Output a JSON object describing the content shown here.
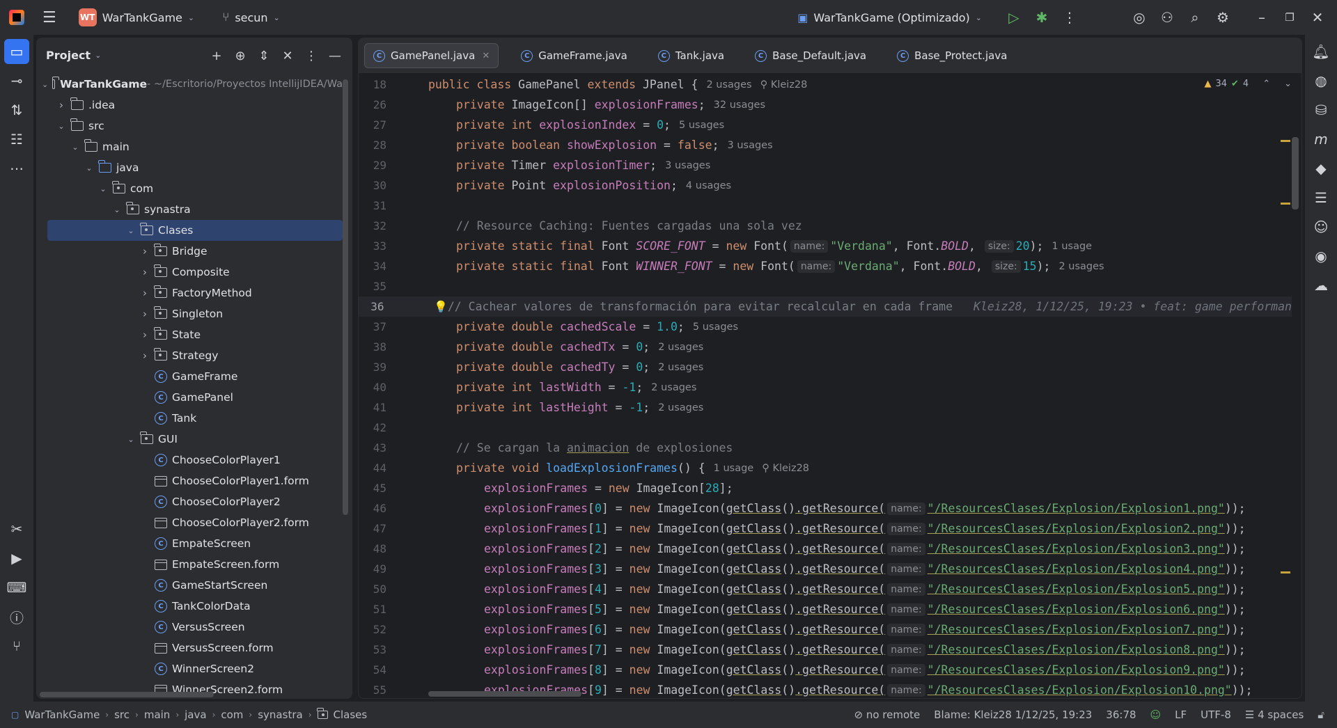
{
  "titlebar": {
    "project_badge": "WT",
    "project_name": "WarTankGame",
    "branch": "secun",
    "run_config": "WarTankGame (Optimizado)"
  },
  "project_panel": {
    "title": "Project",
    "tree": [
      {
        "label": "WarTankGame",
        "suffix": " - ~/Escritorio/Proyectos IntellijIDEA/Wa",
        "depth": 0,
        "kind": "module",
        "expanded": true
      },
      {
        "label": ".idea",
        "depth": 1,
        "kind": "folder",
        "expanded": false
      },
      {
        "label": "src",
        "depth": 1,
        "kind": "folder",
        "expanded": true
      },
      {
        "label": "main",
        "depth": 2,
        "kind": "folder",
        "expanded": true
      },
      {
        "label": "java",
        "depth": 3,
        "kind": "source",
        "expanded": true
      },
      {
        "label": "com",
        "depth": 4,
        "kind": "package",
        "expanded": true
      },
      {
        "label": "synastra",
        "depth": 5,
        "kind": "package",
        "expanded": true
      },
      {
        "label": "Clases",
        "depth": 6,
        "kind": "package",
        "expanded": true,
        "selected": true
      },
      {
        "label": "Bridge",
        "depth": 7,
        "kind": "package",
        "expanded": false
      },
      {
        "label": "Composite",
        "depth": 7,
        "kind": "package",
        "expanded": false
      },
      {
        "label": "FactoryMethod",
        "depth": 7,
        "kind": "package",
        "expanded": false
      },
      {
        "label": "Singleton",
        "depth": 7,
        "kind": "package",
        "expanded": false
      },
      {
        "label": "State",
        "depth": 7,
        "kind": "package",
        "expanded": false
      },
      {
        "label": "Strategy",
        "depth": 7,
        "kind": "package",
        "expanded": false
      },
      {
        "label": "GameFrame",
        "depth": 7,
        "kind": "class"
      },
      {
        "label": "GamePanel",
        "depth": 7,
        "kind": "class"
      },
      {
        "label": "Tank",
        "depth": 7,
        "kind": "class"
      },
      {
        "label": "GUI",
        "depth": 6,
        "kind": "package",
        "expanded": true
      },
      {
        "label": "ChooseColorPlayer1",
        "depth": 7,
        "kind": "class"
      },
      {
        "label": "ChooseColorPlayer1.form",
        "depth": 7,
        "kind": "form"
      },
      {
        "label": "ChooseColorPlayer2",
        "depth": 7,
        "kind": "class"
      },
      {
        "label": "ChooseColorPlayer2.form",
        "depth": 7,
        "kind": "form"
      },
      {
        "label": "EmpateScreen",
        "depth": 7,
        "kind": "class"
      },
      {
        "label": "EmpateScreen.form",
        "depth": 7,
        "kind": "form"
      },
      {
        "label": "GameStartScreen",
        "depth": 7,
        "kind": "class"
      },
      {
        "label": "TankColorData",
        "depth": 7,
        "kind": "class"
      },
      {
        "label": "VersusScreen",
        "depth": 7,
        "kind": "class"
      },
      {
        "label": "VersusScreen.form",
        "depth": 7,
        "kind": "form"
      },
      {
        "label": "WinnerScreen2",
        "depth": 7,
        "kind": "class"
      },
      {
        "label": "WinnerScreen2.form",
        "depth": 7,
        "kind": "form"
      }
    ]
  },
  "tabs": [
    {
      "label": "GamePanel.java",
      "active": true
    },
    {
      "label": "GameFrame.java"
    },
    {
      "label": "Tank.java"
    },
    {
      "label": "Base_Default.java"
    },
    {
      "label": "Base_Protect.java"
    }
  ],
  "inspections": {
    "warnings": "34",
    "ok": "4"
  },
  "code": {
    "l18": {
      "n": "18",
      "kw1": "public class ",
      "name": "GamePanel",
      "kw2": " extends ",
      "sup": "JPanel",
      "brace": " {",
      "hint": "2 usages",
      "author": "Kleiz28"
    },
    "l26": {
      "n": "26",
      "kw": "private ",
      "type": "ImageIcon[] ",
      "fld": "explosionFrames",
      "end": ";",
      "hint": "32 usages"
    },
    "l27": {
      "n": "27",
      "kw": "private int ",
      "fld": "explosionIndex",
      "eq": " = ",
      "num": "0",
      "end": ";",
      "hint": "5 usages"
    },
    "l28": {
      "n": "28",
      "kw": "private boolean ",
      "fld": "showExplosion",
      "eq": " = ",
      "val": "false",
      "end": ";",
      "hint": "3 usages"
    },
    "l29": {
      "n": "29",
      "kw": "private ",
      "type": "Timer ",
      "fld": "explosionTimer",
      "end": ";",
      "hint": "3 usages"
    },
    "l30": {
      "n": "30",
      "kw": "private ",
      "type": "Point ",
      "fld": "explosionPosition",
      "end": ";",
      "hint": "4 usages"
    },
    "l31": {
      "n": "31"
    },
    "l32": {
      "n": "32",
      "cmt": "// Resource Caching: Fuentes cargadas una sola vez"
    },
    "l33": {
      "n": "33",
      "kw": "private static final ",
      "type": "Font ",
      "fld": "SCORE_FONT",
      "eq": " = ",
      "new": "new ",
      "cls": "Font(",
      "p1": "name:",
      "s1": "\"Verdana\"",
      "mid": ", Font.",
      "bold": "BOLD",
      "comma": ", ",
      "p2": "size:",
      "num": "20",
      "end": ");",
      "hint": "1 usage"
    },
    "l34": {
      "n": "34",
      "kw": "private static final ",
      "type": "Font ",
      "fld": "WINNER_FONT",
      "eq": " = ",
      "new": "new ",
      "cls": "Font(",
      "p1": "name:",
      "s1": "\"Verdana\"",
      "mid": ", Font.",
      "bold": "BOLD",
      "comma": ", ",
      "p2": "size:",
      "num": "15",
      "end": ");",
      "hint": "2 usages"
    },
    "l35": {
      "n": "35"
    },
    "l36": {
      "n": "36",
      "cmt": "// Cachear valores de transformación para evitar recalcular en cada frame",
      "blame": "Kleiz28, 1/12/25, 19:23 • feat: game performan"
    },
    "l37": {
      "n": "37",
      "kw": "private double ",
      "fld": "cachedScale",
      "eq": " = ",
      "num": "1.0",
      "end": ";",
      "hint": "5 usages"
    },
    "l38": {
      "n": "38",
      "kw": "private double ",
      "fld": "cachedTx",
      "eq": " = ",
      "num": "0",
      "end": ";",
      "hint": "2 usages"
    },
    "l39": {
      "n": "39",
      "kw": "private double ",
      "fld": "cachedTy",
      "eq": " = ",
      "num": "0",
      "end": ";",
      "hint": "2 usages"
    },
    "l40": {
      "n": "40",
      "kw": "private int ",
      "fld": "lastWidth",
      "eq": " = ",
      "num": "-1",
      "end": ";",
      "hint": "2 usages"
    },
    "l41": {
      "n": "41",
      "kw": "private int ",
      "fld": "lastHeight",
      "eq": " = ",
      "num": "-1",
      "end": ";",
      "hint": "2 usages"
    },
    "l42": {
      "n": "42"
    },
    "l43": {
      "n": "43",
      "c1": "// Se cargan la ",
      "c2": "animacion",
      "c3": " de explosiones"
    },
    "l44": {
      "n": "44",
      "kw": "private void ",
      "fn": "loadExplosionFrames",
      "end": "() {",
      "hint": "1 usage",
      "author": "Kleiz28"
    },
    "l45": {
      "n": "45",
      "fld": "explosionFrames",
      "eq": " = ",
      "new": "new ",
      "rest": "ImageIcon[",
      "num": "28",
      "end": "];"
    },
    "frames": [
      {
        "n": "46",
        "idx": "0",
        "path": "\"/ResourcesClases/Explosion/Explosion1.png\""
      },
      {
        "n": "47",
        "idx": "1",
        "path": "\"/ResourcesClases/Explosion/Explosion2.png\""
      },
      {
        "n": "48",
        "idx": "2",
        "path": "\"/ResourcesClases/Explosion/Explosion3.png\""
      },
      {
        "n": "49",
        "idx": "3",
        "path": "\"/ResourcesClases/Explosion/Explosion4.png\""
      },
      {
        "n": "50",
        "idx": "4",
        "path": "\"/ResourcesClases/Explosion/Explosion5.png\""
      },
      {
        "n": "51",
        "idx": "5",
        "path": "\"/ResourcesClases/Explosion/Explosion6.png\""
      },
      {
        "n": "52",
        "idx": "6",
        "path": "\"/ResourcesClases/Explosion/Explosion7.png\""
      },
      {
        "n": "53",
        "idx": "7",
        "path": "\"/ResourcesClases/Explosion/Explosion8.png\""
      },
      {
        "n": "54",
        "idx": "8",
        "path": "\"/ResourcesClases/Explosion/Explosion9.png\""
      },
      {
        "n": "55",
        "idx": "9",
        "path": "\"/ResourcesClases/Explosion/Explosion10.png\""
      }
    ],
    "frame_parts": {
      "fld": "explosionFrames",
      "eq": "] = ",
      "new": "new ",
      "cls": "ImageIcon(",
      "gc": "getClass",
      "gc2": "()",
      "gr": ".getResource(",
      "p": "name:",
      "end": "));"
    }
  },
  "statusbar": {
    "crumbs": [
      "WarTankGame",
      "src",
      "main",
      "java",
      "com",
      "synastra",
      "Clases"
    ],
    "remote": "no remote",
    "blame": "Blame: Kleiz28 1/12/25, 19:23",
    "position": "36:78",
    "line_sep": "LF",
    "encoding": "UTF-8",
    "indent": "4 spaces"
  },
  "colors": {
    "accent": "#3574f0",
    "bg": "#1e1f22",
    "panel": "#2b2d30",
    "selection": "#2e436e"
  }
}
